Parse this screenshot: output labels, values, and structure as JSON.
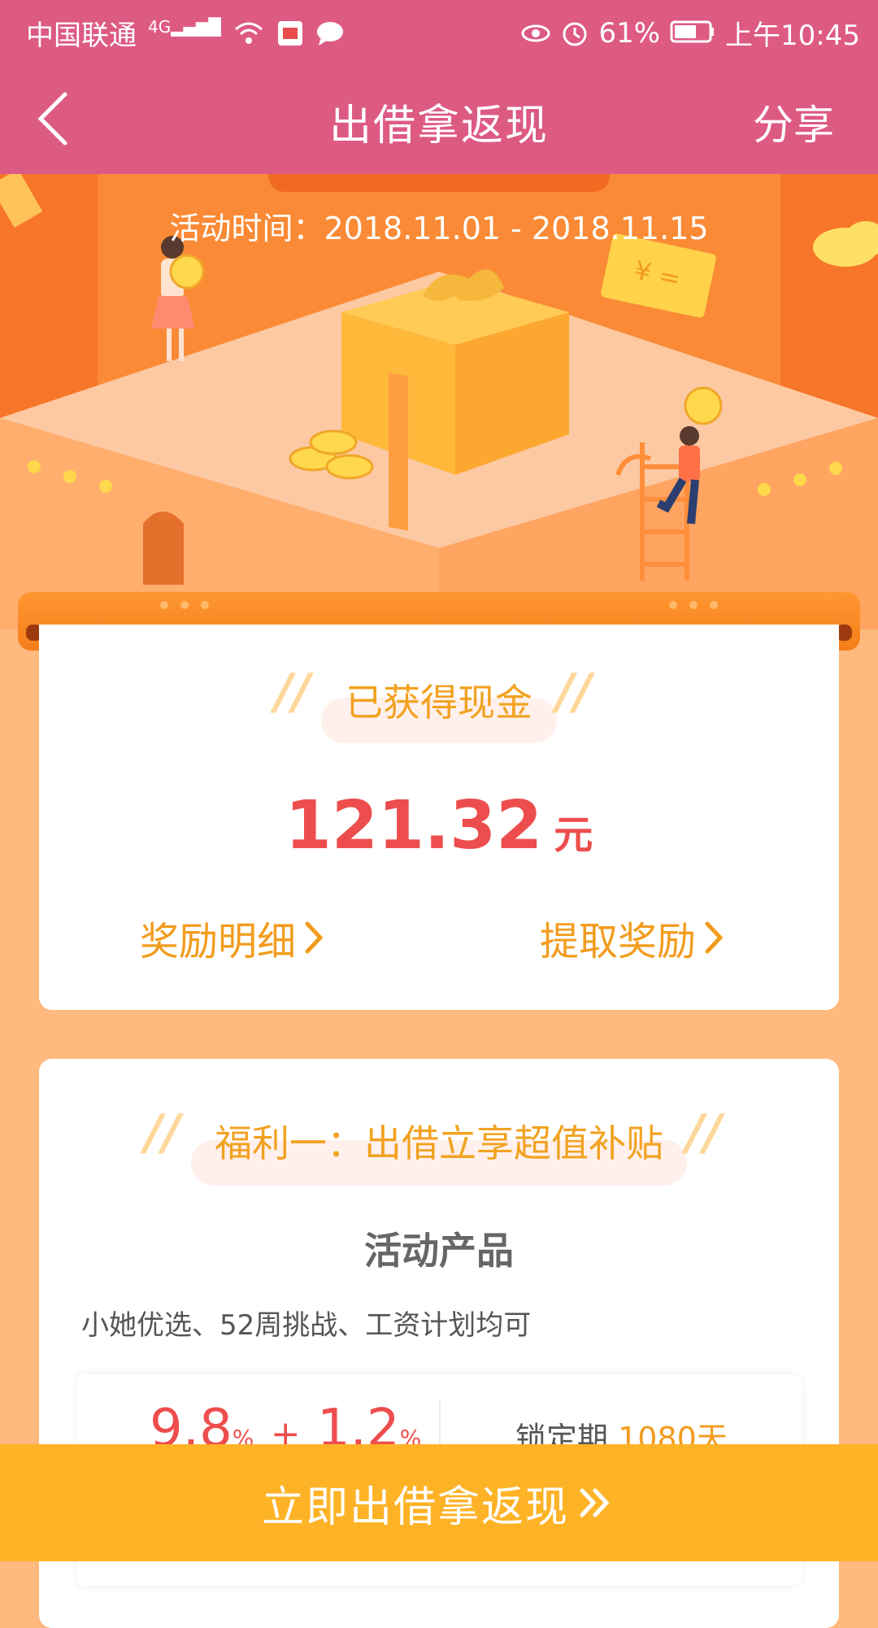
{
  "status_bar": {
    "carrier": "中国联通",
    "network": "4G",
    "battery": "61%",
    "time": "上午10:45"
  },
  "nav": {
    "title": "出借拿返现",
    "share_label": "分享"
  },
  "hero": {
    "activity_time": "活动时间：2018.11.01 - 2018.11.15"
  },
  "earned": {
    "title": "已获得现金",
    "amount": "121.32",
    "unit": "元",
    "detail_link": "奖励明细",
    "withdraw_link": "提取奖励"
  },
  "benefit": {
    "title": "福利一：出借立享超值补贴",
    "subtitle": "活动产品",
    "description": "小她优选、52周挑战、工资计划均可",
    "rate_base": "9.8",
    "rate_extra": "1.2",
    "percent": "%",
    "plus": "+",
    "lock_label": "锁定期",
    "lock_value": "1080天"
  },
  "bottom_button": {
    "label": "立即出借拿返现"
  },
  "colors": {
    "header": "#DD5A83",
    "accent_orange": "#F29C1E",
    "amount_red": "#EE4D4D",
    "button": "#FEB327"
  }
}
